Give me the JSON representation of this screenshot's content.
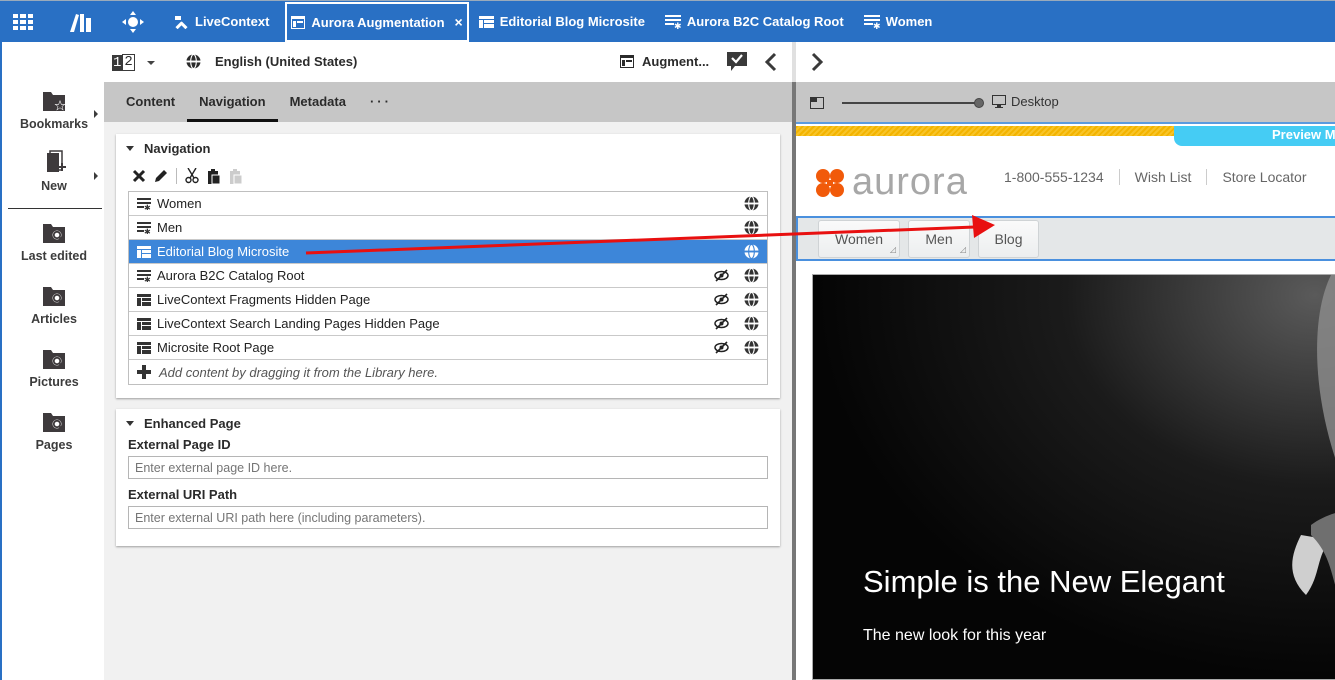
{
  "topbar": {
    "app_icons": [
      "apps-grid-icon",
      "library-icon",
      "move-icon"
    ],
    "tabs": [
      {
        "label": "LiveContext",
        "icon": "tools-icon",
        "active": false
      },
      {
        "label": "Aurora Augmentation",
        "icon": "page-icon",
        "active": true,
        "closable": true
      },
      {
        "label": "Editorial Blog Microsite",
        "icon": "page-icon",
        "active": false
      },
      {
        "label": "Aurora B2C Catalog Root",
        "icon": "category-icon",
        "active": false
      },
      {
        "label": "Women",
        "icon": "category-icon",
        "active": false
      }
    ],
    "close_glyph": "×"
  },
  "rail": {
    "items": [
      {
        "label": "Bookmarks",
        "icon": "bookmark-folder-icon",
        "submenu": true
      },
      {
        "label": "New",
        "icon": "new-document-icon",
        "submenu": true
      },
      {
        "label": "Last edited",
        "icon": "search-folder-icon"
      },
      {
        "label": "Articles",
        "icon": "search-folder-icon"
      },
      {
        "label": "Pictures",
        "icon": "search-folder-icon"
      },
      {
        "label": "Pages",
        "icon": "search-folder-icon"
      }
    ]
  },
  "editor": {
    "version": {
      "left": "1",
      "right": "2"
    },
    "language": "English (United States)",
    "document_title": "Augment...",
    "tabs": [
      {
        "label": "Content",
        "active": false
      },
      {
        "label": "Navigation",
        "active": true
      },
      {
        "label": "Metadata",
        "active": false
      },
      {
        "label": "···",
        "active": false
      }
    ],
    "navigation_panel": {
      "title": "Navigation",
      "toolbar": [
        "delete-icon",
        "edit-icon",
        "cut-icon",
        "paste-icon",
        "paste-disabled-icon"
      ],
      "items": [
        {
          "label": "Women",
          "icon": "category-icon",
          "hidden": false,
          "selected": false
        },
        {
          "label": "Men",
          "icon": "category-icon",
          "hidden": false,
          "selected": false
        },
        {
          "label": "Editorial Blog Microsite",
          "icon": "page-icon",
          "hidden": false,
          "selected": true
        },
        {
          "label": "Aurora B2C Catalog Root",
          "icon": "category-icon",
          "hidden": true,
          "selected": false
        },
        {
          "label": "LiveContext Fragments Hidden Page",
          "icon": "page-icon",
          "hidden": true,
          "selected": false
        },
        {
          "label": "LiveContext Search Landing Pages Hidden Page",
          "icon": "page-icon",
          "hidden": true,
          "selected": false
        },
        {
          "label": "Microsite Root Page",
          "icon": "page-icon",
          "hidden": true,
          "selected": false
        }
      ],
      "add_hint": "Add content by dragging it from the Library here."
    },
    "enhanced_panel": {
      "title": "Enhanced Page",
      "fields": [
        {
          "label": "External Page ID",
          "value": "",
          "placeholder": "Enter external page ID here."
        },
        {
          "label": "External URI Path",
          "value": "",
          "placeholder": "Enter external URI path here (including parameters)."
        }
      ]
    }
  },
  "preview": {
    "device": "Desktop",
    "zoom_fraction": 1.0,
    "badge": "Preview M",
    "site": {
      "logo_text": "aurora",
      "utility_links": [
        "1-800-555-1234",
        "Wish List",
        "Store Locator"
      ],
      "nav": [
        {
          "label": "Women",
          "has_submenu": true
        },
        {
          "label": "Men",
          "has_submenu": true
        },
        {
          "label": "Blog",
          "has_submenu": false
        }
      ],
      "hero_title": "Simple is the New Elegant",
      "hero_subtitle": "The new look for this year"
    }
  },
  "colors": {
    "brand_blue": "#2970c4",
    "selection_blue": "#3d86d9",
    "annotation_red": "#e81010",
    "aurora_orange": "#f15a0a",
    "preview_badge": "#45ccf4"
  }
}
